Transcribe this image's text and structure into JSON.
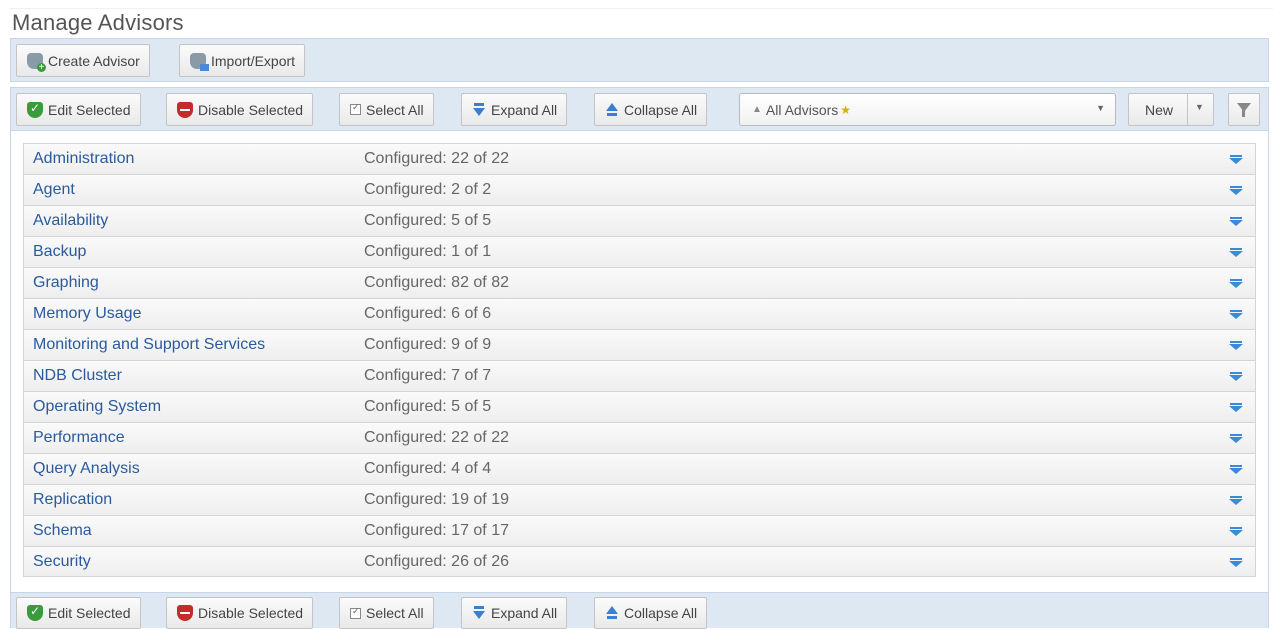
{
  "page": {
    "title": "Manage Advisors"
  },
  "toolbar_top": {
    "create_label": "Create Advisor",
    "import_label": "Import/Export"
  },
  "actions": {
    "edit_label": "Edit Selected",
    "disable_label": "Disable Selected",
    "select_all_label": "Select All",
    "expand_label": "Expand All",
    "collapse_label": "Collapse All",
    "filter_select_value": "All Advisors",
    "new_label": "New"
  },
  "advisor_groups": [
    {
      "name": "Administration",
      "configured": "Configured: 22 of 22"
    },
    {
      "name": "Agent",
      "configured": "Configured: 2 of 2"
    },
    {
      "name": "Availability",
      "configured": "Configured: 5 of 5"
    },
    {
      "name": "Backup",
      "configured": "Configured: 1 of 1"
    },
    {
      "name": "Graphing",
      "configured": "Configured: 82 of 82"
    },
    {
      "name": "Memory Usage",
      "configured": "Configured: 6 of 6"
    },
    {
      "name": "Monitoring and Support Services",
      "configured": "Configured: 9 of 9"
    },
    {
      "name": "NDB Cluster",
      "configured": "Configured: 7 of 7"
    },
    {
      "name": "Operating System",
      "configured": "Configured: 5 of 5"
    },
    {
      "name": "Performance",
      "configured": "Configured: 22 of 22"
    },
    {
      "name": "Query Analysis",
      "configured": "Configured: 4 of 4"
    },
    {
      "name": "Replication",
      "configured": "Configured: 19 of 19"
    },
    {
      "name": "Schema",
      "configured": "Configured: 17 of 17"
    },
    {
      "name": "Security",
      "configured": "Configured: 26 of 26"
    }
  ],
  "icons": {
    "create": "shield-plus-icon",
    "import": "shield-import-icon",
    "edit": "shield-check-icon",
    "disable": "shield-minus-icon",
    "select_all": "checkbox-icon",
    "expand": "expand-all-icon",
    "collapse": "collapse-all-icon",
    "filter": "filter-icon"
  },
  "colors": {
    "toolbar_bg": "#dde8f3",
    "link": "#2a5a9c",
    "edit_icon": "#3a9b3a",
    "disable_icon": "#c62b2b",
    "expand_icon": "#3a8ad8"
  }
}
